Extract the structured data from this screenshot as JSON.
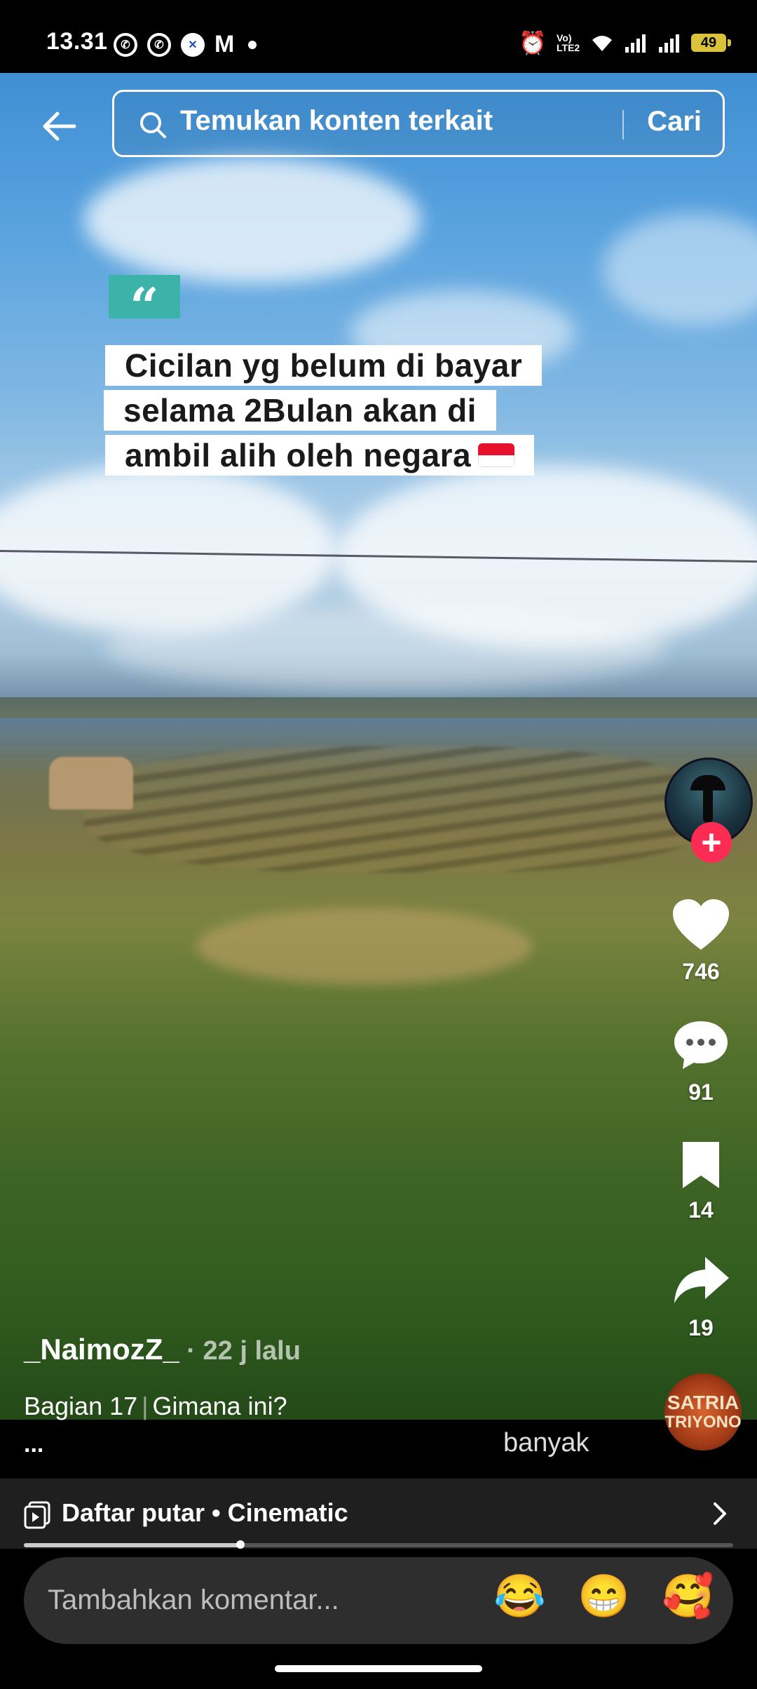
{
  "status_bar": {
    "time": "13.31",
    "battery": "49",
    "network_label": "Vo) LTE2"
  },
  "search": {
    "placeholder": "Temukan konten terkait",
    "button": "Cari"
  },
  "video": {
    "caption_lines": [
      "Cicilan yg belum di bayar",
      "selama 2Bulan akan di",
      "ambil alih oleh negara"
    ],
    "quote_mark": "“"
  },
  "actions": {
    "likes": "746",
    "comments": "91",
    "saves": "14",
    "shares": "19"
  },
  "music_disc": {
    "line1": "SATRIA",
    "line2": "TRIYONO"
  },
  "post": {
    "username": "_NaimozZ_",
    "time": " · 22 j lalu",
    "part": "Bagian 17",
    "separator": "|",
    "text": "Gimana ini?",
    "more": "...",
    "overlay_word": "banyak"
  },
  "playlist": {
    "label": "Daftar putar • Cinematic",
    "progress": 0.305
  },
  "comment": {
    "placeholder": "Tambahkan komentar...",
    "emojis": [
      "😂",
      "😁",
      "🥰"
    ]
  },
  "colors": {
    "accent": "#fe2c55",
    "quote_badge": "#3bb3a8",
    "battery": "#d8c33a"
  }
}
